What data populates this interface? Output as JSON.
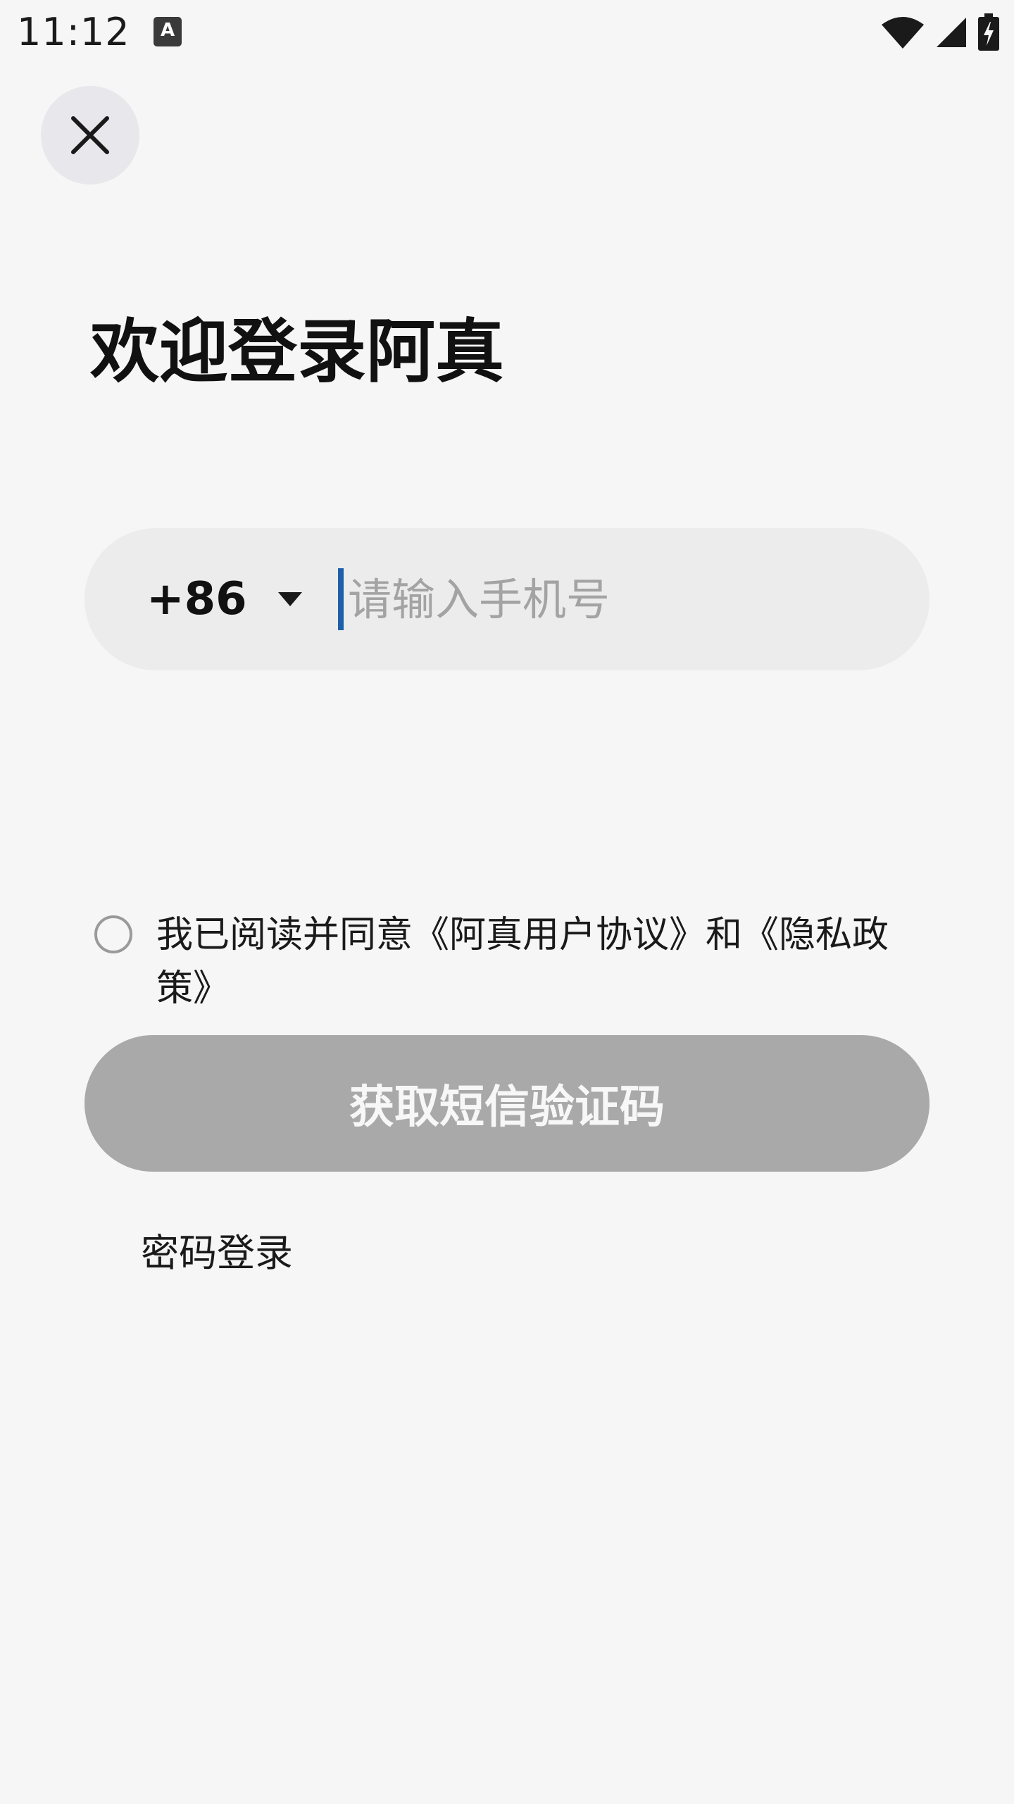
{
  "status_bar": {
    "time": "11:12",
    "notification_glyph": "A",
    "icons": [
      "wifi-icon",
      "signal-icon",
      "battery-charging-icon"
    ]
  },
  "header": {
    "close_icon": "close-icon"
  },
  "main": {
    "title": "欢迎登录阿真",
    "phone": {
      "country_code": "+86",
      "placeholder": "请输入手机号",
      "value": ""
    },
    "agreement": {
      "checked": false,
      "text": "我已阅读并同意《阿真用户协议》和《隐私政策》"
    },
    "sms_button_label": "获取短信验证码",
    "password_login_label": "密码登录"
  },
  "colors": {
    "background": "#f6f6f6",
    "input_background": "#ececec",
    "button_disabled": "#a9a9a9",
    "cursor": "#1f5fa8"
  }
}
